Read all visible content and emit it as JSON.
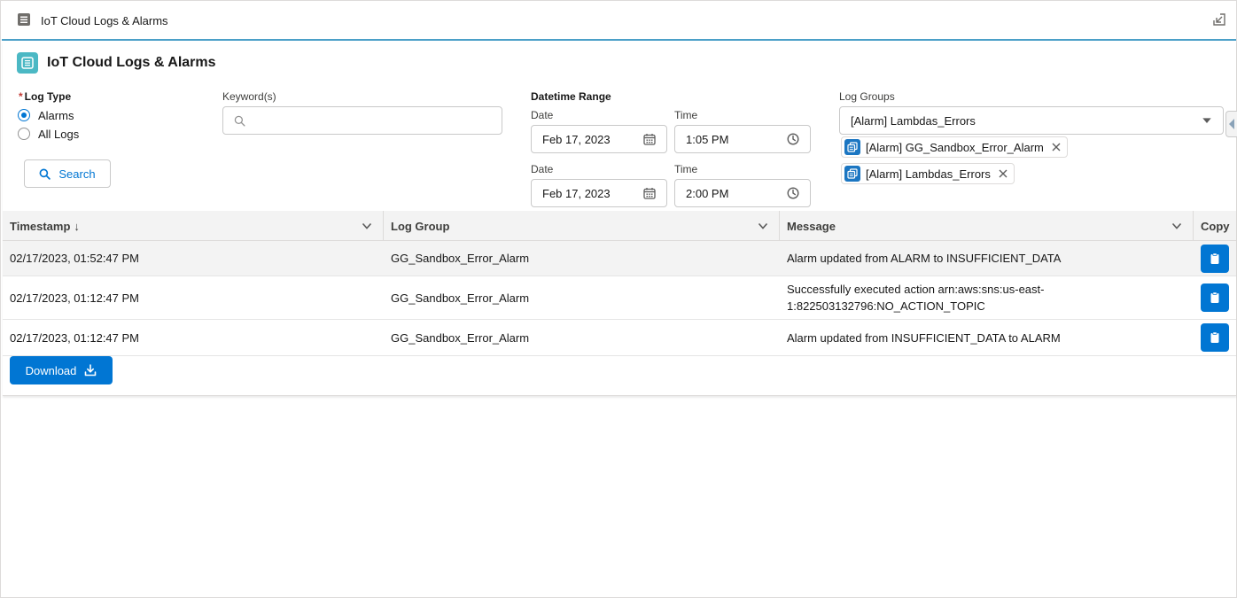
{
  "window": {
    "tab_title": "IoT Cloud Logs & Alarms"
  },
  "card": {
    "title": "IoT Cloud Logs & Alarms"
  },
  "log_type": {
    "label": "Log Type",
    "required_marker": "*",
    "options": [
      {
        "label": "Alarms",
        "checked": true
      },
      {
        "label": "All Logs",
        "checked": false
      }
    ]
  },
  "search_button": {
    "label": "Search"
  },
  "keywords": {
    "label": "Keyword(s)",
    "value": "",
    "placeholder": ""
  },
  "datetime": {
    "label": "Datetime Range",
    "start": {
      "date_label": "Date",
      "date_value": "Feb 17, 2023",
      "time_label": "Time",
      "time_value": "1:05 PM"
    },
    "end": {
      "date_label": "Date",
      "date_value": "Feb 17, 2023",
      "time_label": "Time",
      "time_value": "2:00 PM"
    }
  },
  "log_groups": {
    "label": "Log Groups",
    "selected": "[Alarm] Lambdas_Errors",
    "pills": [
      "[Alarm] GG_Sandbox_Error_Alarm",
      "[Alarm] Lambdas_Errors"
    ]
  },
  "table": {
    "columns": {
      "timestamp": "Timestamp",
      "sort_arrow": "↓",
      "log_group": "Log Group",
      "message": "Message",
      "copy": "Copy"
    },
    "rows": [
      {
        "timestamp": "02/17/2023, 01:52:47 PM",
        "log_group": "GG_Sandbox_Error_Alarm",
        "message": "Alarm updated from ALARM to INSUFFICIENT_DATA"
      },
      {
        "timestamp": "02/17/2023, 01:12:47 PM",
        "log_group": "GG_Sandbox_Error_Alarm",
        "message": "Successfully executed action arn:aws:sns:us-east-1:822503132796:NO_ACTION_TOPIC"
      },
      {
        "timestamp": "02/17/2023, 01:12:47 PM",
        "log_group": "GG_Sandbox_Error_Alarm",
        "message": "Alarm updated from INSUFFICIENT_DATA to ALARM"
      }
    ]
  },
  "download_button": {
    "label": "Download"
  },
  "colors": {
    "brand": "#0176d3",
    "accent_line": "#4ba0c8",
    "card_icon": "#4bb8c4",
    "required": "#c23934"
  }
}
